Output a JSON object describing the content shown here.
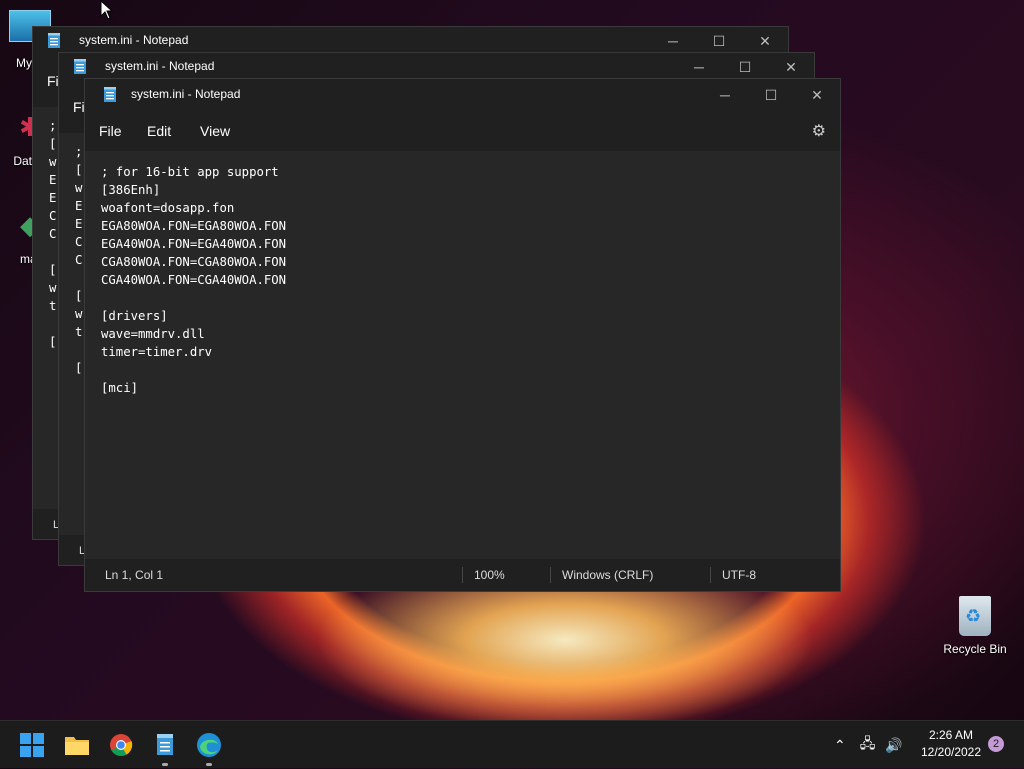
{
  "desktop": {
    "icons": [
      {
        "label": "My C"
      },
      {
        "label": "DataV"
      },
      {
        "label": "mat"
      },
      {
        "label": "Recycle Bin"
      }
    ]
  },
  "windows": [
    {
      "title": "system.ini - Notepad",
      "menu_label": "Fil",
      "text": ";\n[\nw\nE(\nE(\nC(\nC(\n\n[(\nw\nt\n\n[(",
      "status_label": "L"
    },
    {
      "title": "system.ini - Notepad",
      "menu_label": "Fil",
      "text": ";\n[\nw\nE(\nE(\nC(\nC(\n\n[(\nw\nt\n\n[(",
      "status_label": "L"
    },
    {
      "title": "system.ini - Notepad",
      "menu": [
        "File",
        "Edit",
        "View"
      ],
      "text": "; for 16-bit app support\n[386Enh]\nwoafont=dosapp.fon\nEGA80WOA.FON=EGA80WOA.FON\nEGA40WOA.FON=EGA40WOA.FON\nCGA80WOA.FON=CGA80WOA.FON\nCGA40WOA.FON=CGA40WOA.FON\n\n[drivers]\nwave=mmdrv.dll\ntimer=timer.drv\n\n[mci]",
      "status": {
        "position": "Ln 1, Col 1",
        "zoom": "100%",
        "line_ending": "Windows (CRLF)",
        "encoding": "UTF-8"
      }
    }
  ],
  "taskbar": {
    "apps": [
      "start-icon",
      "file-explorer-icon",
      "chrome-icon",
      "notepad-icon",
      "edge-icon"
    ],
    "clock": {
      "time": "2:26 AM",
      "date": "12/20/2022"
    },
    "notification_count": "2"
  },
  "colors": {
    "window_bg": "#202020",
    "editor_bg": "#272727",
    "taskbar_bg": "#1c1c1c",
    "accent": "#c49bd7"
  }
}
